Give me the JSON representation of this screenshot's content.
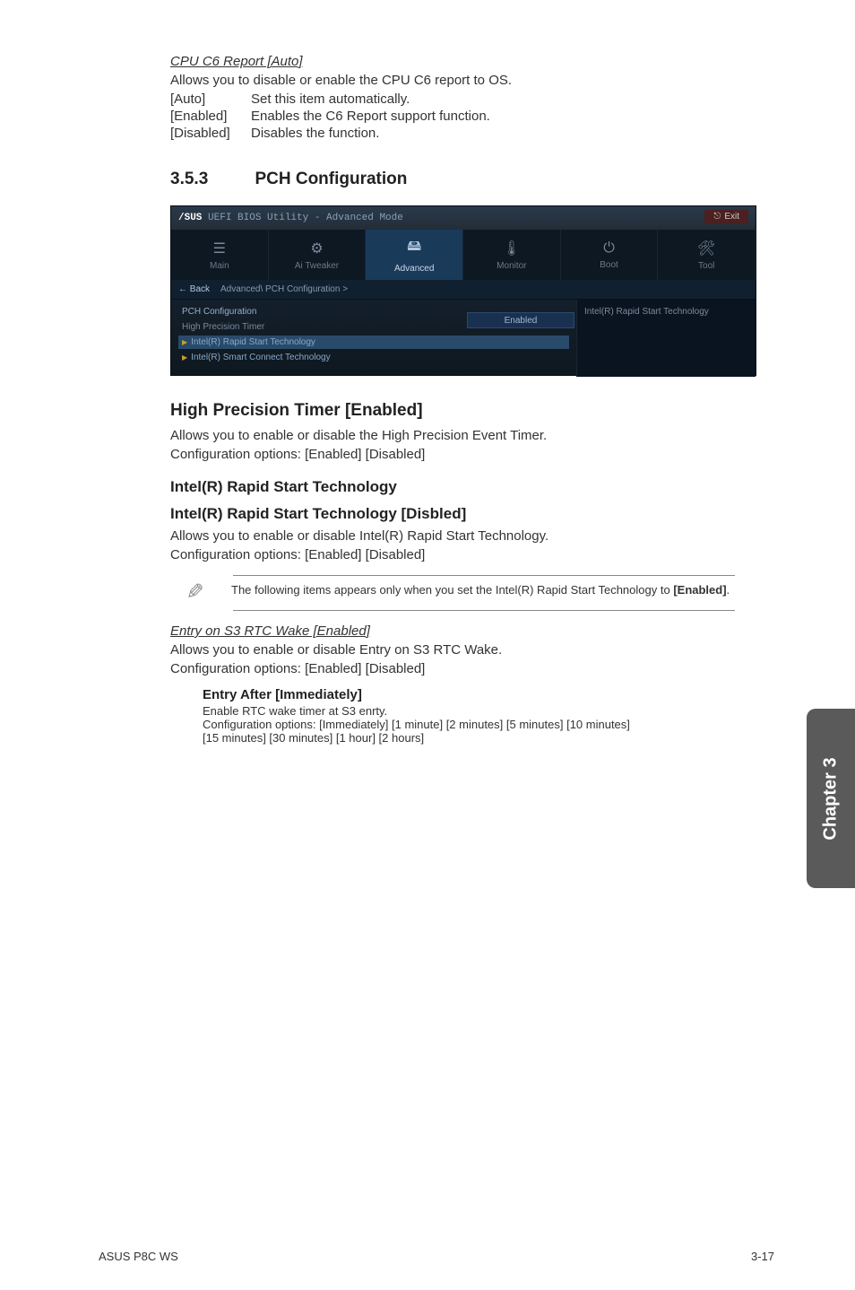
{
  "cpuReport": {
    "title": "CPU C6 Report [Auto]",
    "desc": "Allows you to disable or enable the CPU C6 report to OS.",
    "options": [
      {
        "key": "[Auto]",
        "val": "Set this item automatically."
      },
      {
        "key": "[Enabled]",
        "val": "Enables the C6 Report support function."
      },
      {
        "key": "[Disabled]",
        "val": "Disables the function."
      }
    ]
  },
  "section": {
    "number": "3.5.3",
    "title": "PCH Configuration"
  },
  "bios": {
    "brand": "/SUS",
    "titlebar": "UEFI BIOS Utility - Advanced Mode",
    "exit": "Exit",
    "tabs": [
      {
        "icon": "☰",
        "label": "Main"
      },
      {
        "icon": "⚙",
        "label": "Ai Tweaker"
      },
      {
        "icon": "🖴",
        "label": "Advanced"
      },
      {
        "icon": "🌡",
        "label": "Monitor"
      },
      {
        "icon": "⏻",
        "label": "Boot"
      },
      {
        "icon": "🛠",
        "label": "Tool"
      }
    ],
    "back": "← Back",
    "breadcrumb": "Advanced\\ PCH Configuration >",
    "leftTitle": "PCH Configuration",
    "leftRow": "High Precision Timer",
    "link1": "Intel(R) Rapid Start Technology",
    "link2": "Intel(R) Smart Connect Technology",
    "dropdown": "Enabled",
    "rightInfo": "Intel(R) Rapid Start Technology"
  },
  "hpt": {
    "title": "High Precision Timer [Enabled]",
    "desc": "Allows you to enable or disable the High Precision Event Timer.",
    "config": "Configuration options: [Enabled] [Disabled]"
  },
  "rst": {
    "title": "Intel(R) Rapid Start Technology",
    "subTitle": "Intel(R) Rapid Start Technology [Disbled]",
    "desc": "Allows you to enable or disable Intel(R) Rapid Start Technology.",
    "config": "Configuration options: [Enabled] [Disabled]"
  },
  "note": {
    "text": "The following items appears only when you set the Intel(R) Rapid Start Technology to ",
    "bold": "[Enabled]",
    "suffix": "."
  },
  "entry": {
    "title": "Entry on S3 RTC Wake [Enabled]",
    "desc": "Allows you to enable or disable Entry on S3 RTC Wake.",
    "config": "Configuration options: [Enabled] [Disabled]"
  },
  "entryAfter": {
    "title": "Entry After [Immediately]",
    "line1": "Enable RTC wake timer at S3 enrty.",
    "line2": "Configuration options: [Immediately] [1 minute] [2 minutes] [5 minutes] [10 minutes]",
    "line3": "[15 minutes] [30 minutes] [1 hour] [2 hours]"
  },
  "sideTab": "Chapter 3",
  "footer": {
    "left": "ASUS P8C WS",
    "right": "3-17"
  }
}
